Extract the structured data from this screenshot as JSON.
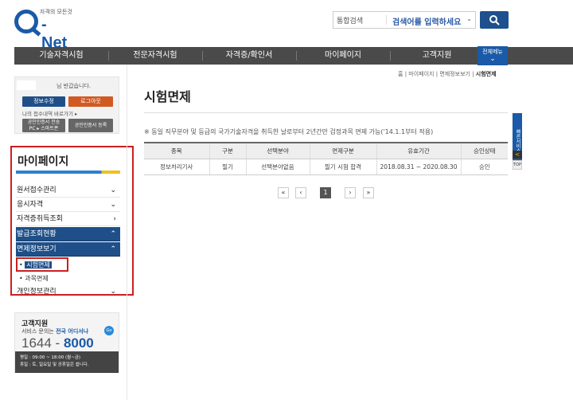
{
  "header": {
    "logo_tagline": "자격의 모든것",
    "logo_text": "Net",
    "search_select": "통합검색",
    "search_placeholder": "검색어를 입력하세요",
    "search_dropdown": "⌄"
  },
  "nav": {
    "items": [
      "기술자격시험",
      "전문자격시험",
      "자격증/확인서",
      "마이페이지",
      "고객지원"
    ],
    "all_menu": "전체메뉴",
    "all_chevron": "⌄"
  },
  "login": {
    "welcome": "님 반갑습니다.",
    "edit": "정보수정",
    "logout": "로그아웃",
    "link": "나의 접수내역 바로가기 ▸",
    "cert_register_pc": "공인인증서 전송",
    "cert_pc_line": "PC ▸ 스마트폰",
    "cert_register": "공인인증서 등록"
  },
  "mypage": {
    "title": "마이페이지",
    "menu": [
      {
        "label": "원서접수관리",
        "arrow": "⌄"
      },
      {
        "label": "응시자격",
        "arrow": "⌄"
      },
      {
        "label": "자격증취득조회",
        "arrow": "›"
      },
      {
        "label": "발급조회현황",
        "arrow": "⌃"
      },
      {
        "label": "면제정보보기",
        "arrow": "⌃"
      },
      {
        "label": "개인정보관리",
        "arrow": "⌄"
      }
    ],
    "sub": [
      "시험면제",
      "과목면제"
    ],
    "bullet": "•"
  },
  "support": {
    "title": "고객지원",
    "desc": "서비스 문의는",
    "desc_bold": "전국 어디서나",
    "go": "Go",
    "phone1": "1644 -",
    "phone2": "8000",
    "hours1": "평일 : 09:00 ~ 18:00 (월~금)",
    "hours2": "휴일 : 토, 일요일 및 공휴일은 쉽니다."
  },
  "breadcrumb": {
    "home": "홈",
    "sep": "|",
    "items": [
      "마이페이지",
      "면제정보보기"
    ],
    "current": "시험면제"
  },
  "page": {
    "title": "시험면제",
    "note": "※ 동일 직무분야 및 등급의 국가기술자격을 취득한 날로부터 2년간만 검정과목 면제 가능('14.1.1부터 적용)"
  },
  "table": {
    "headers": [
      "종목",
      "구분",
      "선택분야",
      "면제구분",
      "유효기간",
      "승인상태"
    ],
    "rows": [
      [
        "정보처리기사",
        "필기",
        "선택분야없음",
        "필기 시험 합격",
        "2018.08.31 ~ 2020.08.30",
        "승인"
      ]
    ]
  },
  "pagination": {
    "first": "«",
    "prev": "‹",
    "current": "1",
    "next": "›",
    "last": "»"
  },
  "quick": {
    "label": "빠른서비스",
    "arrow": "<",
    "top": "TOP"
  }
}
